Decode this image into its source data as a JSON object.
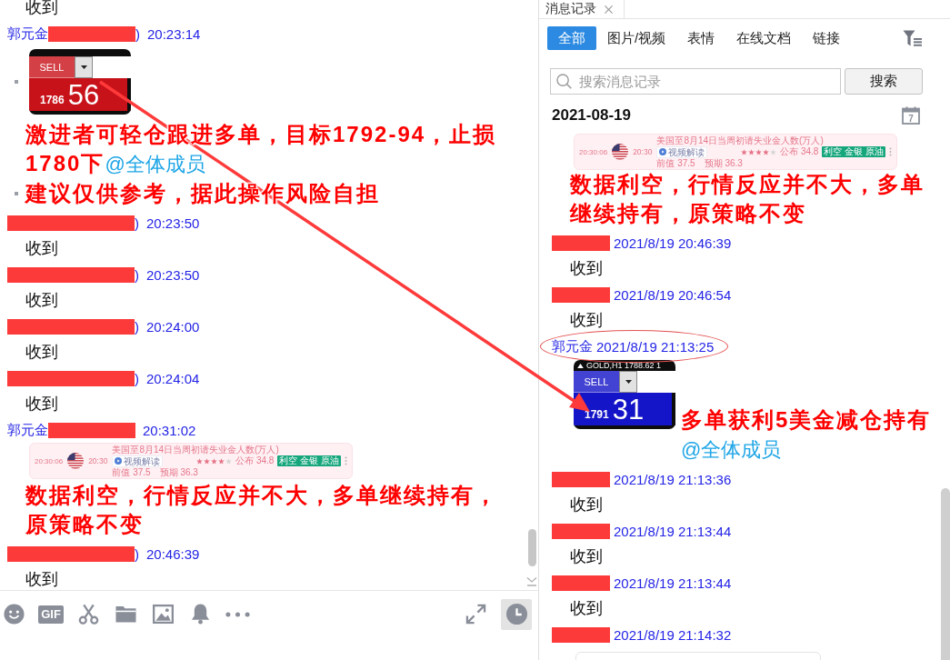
{
  "chat": {
    "messages": [
      {
        "content": [
          {
            "kind": "text",
            "bullet": false,
            "text": "收到"
          }
        ]
      },
      {
        "header": {
          "sender": "郭元金",
          "redacted": true,
          "sender_end": ")",
          "time": "20:23:14",
          "highlighted": false
        },
        "content": [
          {
            "kind": "order-widget",
            "bullet": true,
            "color": "#c8121a",
            "action": "SELL",
            "price_small": "1786",
            "price_big": "56"
          },
          {
            "kind": "alert",
            "bullet": false,
            "text": "激进者可轻仓跟进多单，目标1792-94，止损1780下",
            "mention": "@全体成员"
          },
          {
            "kind": "alert",
            "bullet": true,
            "text": "建议仅供参考，据此操作风险自担"
          }
        ]
      },
      {
        "header": {
          "redacted": true,
          "sender_end": ")",
          "time": "20:23:50",
          "highlighted": false
        },
        "content": [
          {
            "kind": "text",
            "bullet": false,
            "text": "收到"
          }
        ]
      },
      {
        "header": {
          "redacted": true,
          "sender_end": ")",
          "time": "20:23:50",
          "highlighted": false
        },
        "content": [
          {
            "kind": "text",
            "bullet": false,
            "text": "收到"
          }
        ]
      },
      {
        "header": {
          "redacted": true,
          "sender_end": ")",
          "time": "20:24:00",
          "highlighted": false
        },
        "content": [
          {
            "kind": "text",
            "bullet": false,
            "text": "收到"
          }
        ]
      },
      {
        "header": {
          "redacted": true,
          "sender_end": ")",
          "time": "20:24:04",
          "highlighted": false
        },
        "content": [
          {
            "kind": "text",
            "bullet": false,
            "text": "收到"
          }
        ]
      },
      {
        "header": {
          "sender": "郭元金",
          "redacted": true,
          "time": "20:31:02",
          "highlighted": false
        },
        "content": [
          {
            "kind": "calendar-card",
            "bullet": false,
            "released": "20:30:06",
            "time": "20:30",
            "title": "美国至8月14日当周初请失业金人数(万人)",
            "badge": "视频解读",
            "stars": 4,
            "actual": "公布 34.8",
            "tag": "利空 金银 原油",
            "previous": "前值 37.5",
            "forecast": "预期 36.3"
          },
          {
            "kind": "alert",
            "bullet": false,
            "text": "数据利空，行情反应并不大，多单继续持有，原策略不变"
          }
        ]
      },
      {
        "header": {
          "redacted": true,
          "sender_end": ")",
          "time": "20:46:39",
          "highlighted": false
        },
        "content": [
          {
            "kind": "text",
            "bullet": false,
            "text": "收到"
          }
        ]
      }
    ]
  },
  "toolbar": {
    "left": [
      {
        "kind": "emoji",
        "active": false
      },
      {
        "kind": "gif",
        "label": "GIF",
        "active": false
      },
      {
        "kind": "scissors",
        "active": false
      },
      {
        "kind": "folder",
        "active": false
      },
      {
        "kind": "image",
        "active": false
      },
      {
        "kind": "bell",
        "active": false
      },
      {
        "kind": "more",
        "active": false
      }
    ],
    "right": [
      {
        "kind": "expand",
        "active": false
      },
      {
        "kind": "history",
        "active": true
      }
    ]
  },
  "history": {
    "tab": {
      "title": "消息记录"
    },
    "filters": [
      {
        "label": "全部",
        "selected": true
      },
      {
        "label": "图片/视频",
        "selected": false
      },
      {
        "label": "表情",
        "selected": false
      },
      {
        "label": "在线文档",
        "selected": false
      },
      {
        "label": "链接",
        "selected": false
      }
    ],
    "search": {
      "placeholder": "搜索消息记录",
      "button": "搜索"
    },
    "date": {
      "label": "2021-08-19",
      "calendar_day": "7"
    },
    "messages": [
      {
        "content": [
          {
            "kind": "calendar-card",
            "bullet": false,
            "released": "20:30:06",
            "time": "20:30",
            "title": "美国至8月14日当周初请失业金人数(万人)",
            "badge": "视频解读",
            "stars": 4,
            "actual": "公布 34.8",
            "tag": "利空 金银 原油",
            "previous": "前值 37.5",
            "forecast": "预期 36.3"
          },
          {
            "kind": "alert",
            "bullet": false,
            "text": "数据利空，行情反应并不大，多单继续持有，原策略不变"
          }
        ]
      },
      {
        "header": {
          "redacted": true,
          "time": "2021/8/19 20:46:39",
          "highlighted": false
        },
        "content": [
          {
            "kind": "text",
            "bullet": false,
            "text": "收到"
          }
        ]
      },
      {
        "header": {
          "redacted": true,
          "time": "2021/8/19 20:46:54",
          "highlighted": false
        },
        "content": [
          {
            "kind": "text",
            "bullet": false,
            "text": "收到"
          }
        ]
      },
      {
        "header": {
          "sender": "郭元金",
          "redacted": false,
          "time": "2021/8/19 21:13:25",
          "highlighted": true
        },
        "content": [
          {
            "kind": "order-widget",
            "bullet": false,
            "color": "#1414c8",
            "header": "GOLD,H1 1788.62 1",
            "action": "SELL",
            "price_small": "1791",
            "price_big": "31"
          },
          {
            "kind": "alert",
            "bullet": false,
            "text": "多单获利5美金减仓持有",
            "mention": "@全体成员"
          }
        ]
      },
      {
        "header": {
          "redacted": true,
          "time": "2021/8/19 21:13:36",
          "highlighted": false
        },
        "content": [
          {
            "kind": "text",
            "bullet": false,
            "text": "收到"
          }
        ]
      },
      {
        "header": {
          "redacted": true,
          "time": "2021/8/19 21:13:44",
          "highlighted": false
        },
        "content": [
          {
            "kind": "text",
            "bullet": false,
            "text": "收到"
          }
        ]
      },
      {
        "header": {
          "redacted": true,
          "time": "2021/8/19 21:13:44",
          "highlighted": false
        },
        "content": [
          {
            "kind": "text",
            "bullet": false,
            "text": "收到"
          }
        ]
      },
      {
        "header": {
          "redacted": true,
          "time": "2021/8/19 21:14:32",
          "highlighted": false
        },
        "content": [
          {
            "kind": "partial-card",
            "bullet": false
          }
        ]
      }
    ]
  },
  "annotations": [
    {
      "kind": "arrow"
    }
  ]
}
